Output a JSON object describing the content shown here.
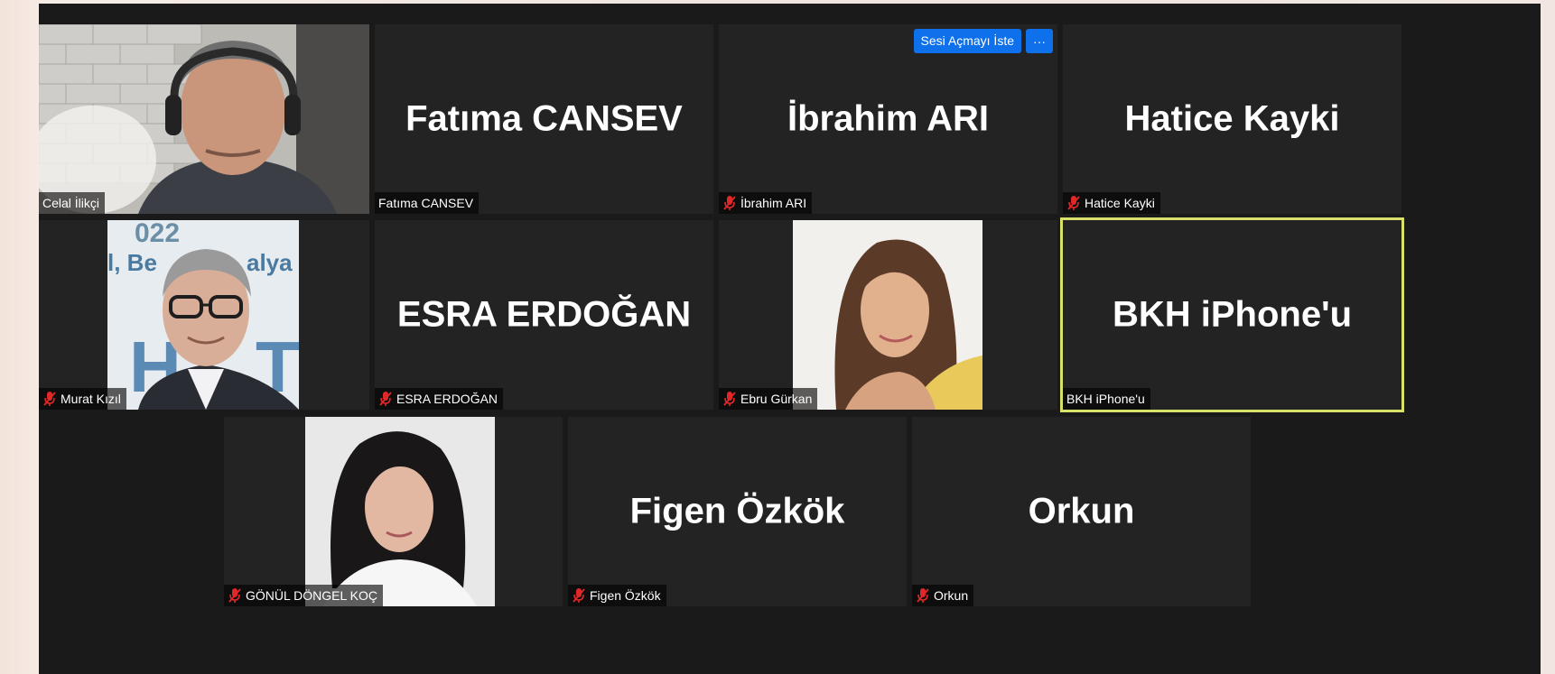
{
  "tiles": [
    {
      "name": "Celal İlikçi",
      "label": "Celal İlikçi",
      "muted": false
    },
    {
      "name": "Fatıma CANSEV",
      "label": "Fatıma CANSEV",
      "muted": false
    },
    {
      "name": "İbrahim ARI",
      "label": "İbrahim ARI",
      "muted": true,
      "action_label": "Sesi Açmayı İste",
      "more_label": "···"
    },
    {
      "name": "Hatice Kayki",
      "label": "Hatice Kayki",
      "muted": true
    },
    {
      "name": "Murat Kızıl",
      "label": "Murat Kızıl",
      "muted": true,
      "backdrop_text_1": "022",
      "backdrop_text_2": "l, Be",
      "backdrop_text_3": "alya",
      "backdrop_text_4": "H",
      "backdrop_text_5": "T"
    },
    {
      "name": "ESRA ERDOĞAN",
      "label": "ESRA ERDOĞAN",
      "muted": true
    },
    {
      "name": "Ebru Gürkan",
      "label": "Ebru Gürkan",
      "muted": true
    },
    {
      "name": "BKH iPhone'u",
      "label": "BKH iPhone'u",
      "muted": false,
      "active_speaker": true
    },
    {
      "name": "GÖNÜL DÖNGEL KOÇ",
      "label": "GÖNÜL DÖNGEL KOÇ",
      "muted": true
    },
    {
      "name": "Figen Özkök",
      "label": "Figen Özkök",
      "muted": true
    },
    {
      "name": "Orkun",
      "label": "Orkun",
      "muted": true
    }
  ],
  "colors": {
    "tile_bg": "#232323",
    "active_border": "#d8e26a",
    "button_blue": "#0e71eb",
    "muted_icon": "#e02828"
  },
  "icons": {
    "muted": "mic-muted-icon",
    "more": "more-icon"
  }
}
